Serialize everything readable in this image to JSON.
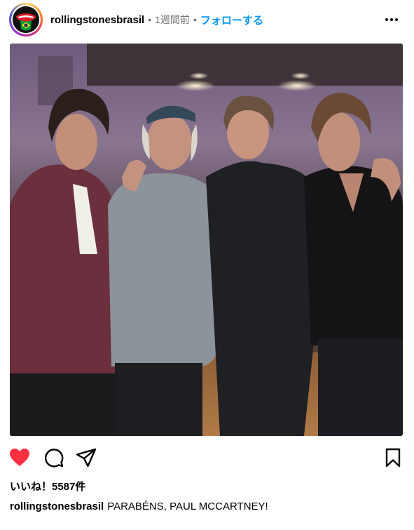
{
  "header": {
    "username": "rollingstonesbrasil",
    "separator": "•",
    "time_ago": "1週間前",
    "follow_label": "フォローする",
    "avatar_icon": "rolling-stones-tongue-brazil-flag-logo"
  },
  "post": {
    "image_icon": "group-photo-four-men-studio",
    "liked": true,
    "like_color": "#ff3040"
  },
  "actions": {
    "like_icon": "heart-icon",
    "comment_icon": "comment-icon",
    "share_icon": "send-icon",
    "save_icon": "bookmark-icon"
  },
  "likes": {
    "text": "いいね！5587件"
  },
  "caption": {
    "username": "rollingstonesbrasil",
    "text": "PARABÉNS, PAUL MCCARTNEY!"
  },
  "colors": {
    "link": "#0095f6",
    "muted": "#737373",
    "text": "#000000"
  }
}
